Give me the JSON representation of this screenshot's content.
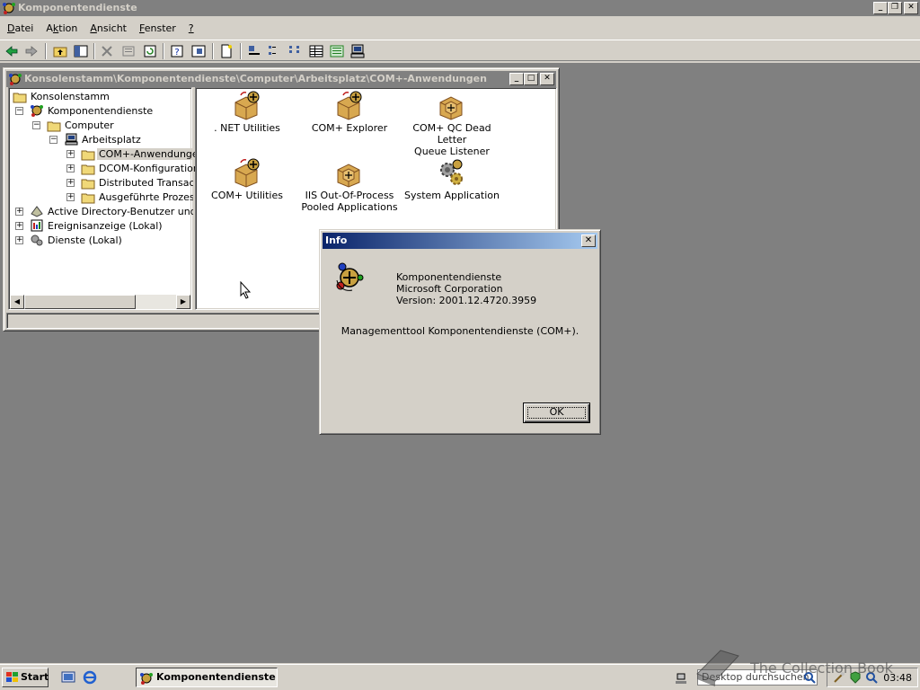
{
  "app": {
    "title": "Komponentendienste",
    "menu": [
      {
        "label": "Datei",
        "underline": "D",
        "rest": "atei"
      },
      {
        "label": "Aktion",
        "underline": "k",
        "pre": "A",
        "rest": "tion"
      },
      {
        "label": "Ansicht",
        "underline": "A",
        "rest": "nsicht"
      },
      {
        "label": "Fenster",
        "underline": "F",
        "rest": "enster"
      },
      {
        "label": "?",
        "underline": "?",
        "rest": ""
      }
    ]
  },
  "console": {
    "title": "Konsolenstamm\\Komponentendienste\\Computer\\Arbeitsplatz\\COM+-Anwendungen",
    "tree": [
      {
        "label": "Konsolenstamm"
      },
      {
        "label": "Komponentendienste"
      },
      {
        "label": "Computer"
      },
      {
        "label": "Arbeitsplatz"
      },
      {
        "label": "COM+-Anwendungen"
      },
      {
        "label": "DCOM-Konfiguration"
      },
      {
        "label": "Distributed Transactio"
      },
      {
        "label": "Ausgeführte Prozesse"
      },
      {
        "label": "Active Directory-Benutzer und -C"
      },
      {
        "label": "Ereignisanzeige (Lokal)"
      },
      {
        "label": "Dienste (Lokal)"
      }
    ],
    "apps": [
      {
        "line1": ". NET Utilities",
        "line2": ""
      },
      {
        "line1": "COM+ Explorer",
        "line2": ""
      },
      {
        "line1": "COM+ QC Dead Letter",
        "line2": "Queue Listener"
      },
      {
        "line1": "COM+ Utilities",
        "line2": ""
      },
      {
        "line1": "IIS Out-Of-Process",
        "line2": "Pooled Applications"
      },
      {
        "line1": "System Application",
        "line2": ""
      }
    ]
  },
  "dialog": {
    "title": "Info",
    "product": "Komponentendienste",
    "company": "Microsoft Corporation",
    "version": "Version: 2001.12.4720.3959",
    "description": "Managementtool Komponentendienste (COM+).",
    "ok_label": "OK"
  },
  "taskbar": {
    "start_label": "Start",
    "task_label": "Komponentendienste",
    "search_placeholder": "Desktop durchsuchen",
    "clock": "03:48",
    "watermark": "The Collection Book"
  }
}
